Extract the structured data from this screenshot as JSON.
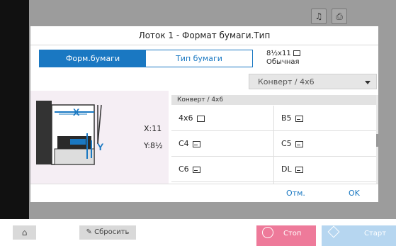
{
  "dialog": {
    "title": "Лоток 1 - Формат бумаги.Тип",
    "tabs": [
      {
        "label": "Форм.бумаги",
        "active": true
      },
      {
        "label": "Тип бумаги",
        "active": false
      }
    ],
    "summary": {
      "size": "8½x11",
      "type": "Обычная"
    },
    "dropdown": {
      "value": "Конверт  /  4x6"
    },
    "dimensions": {
      "x": "X:11",
      "y": "Y:8½"
    },
    "list_header": "Конверт  /  4x6",
    "sizes": [
      {
        "label": "4x6",
        "icon": "portrait-doc-icon"
      },
      {
        "label": "B5",
        "icon": "envelope-icon"
      },
      {
        "label": "C4",
        "icon": "envelope-icon"
      },
      {
        "label": "C5",
        "icon": "envelope-icon"
      },
      {
        "label": "C6",
        "icon": "envelope-icon"
      },
      {
        "label": "DL",
        "icon": "envelope-icon"
      }
    ],
    "buttons": {
      "cancel": "Отм.",
      "ok": "OK"
    }
  },
  "bottom_bar": {
    "reset": "Сбросить",
    "stop": "Стоп",
    "start": "Старт"
  },
  "colors": {
    "accent": "#1a78c2",
    "stop": "#ee7a9a",
    "start": "#b6d6f0"
  }
}
